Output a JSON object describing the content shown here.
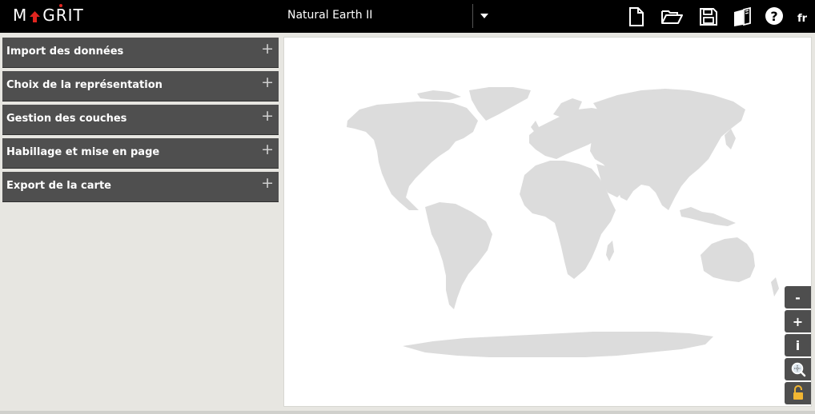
{
  "app": {
    "logo_text_left": "M",
    "logo_text_right": "GRIT",
    "brand_accent": "#e1251f",
    "bar_color": "#000000"
  },
  "header": {
    "projection": "Natural Earth II",
    "language": "fr",
    "icons": [
      "new-file-icon",
      "open-folder-icon",
      "save-icon",
      "book-icon",
      "help-icon"
    ]
  },
  "menu": {
    "items": [
      {
        "label": "Import des données",
        "toggle": "+"
      },
      {
        "label": "Choix de la représentation",
        "toggle": "+"
      },
      {
        "label": "Gestion des couches",
        "toggle": "+"
      },
      {
        "label": "Habillage et mise en page",
        "toggle": "+"
      },
      {
        "label": "Export de la carte",
        "toggle": "+"
      }
    ]
  },
  "map": {
    "land_color": "#dcdcdc",
    "controls": {
      "zoom_out": "-",
      "zoom_in": "+",
      "info": "i",
      "zoom_extent_icon": "magnifier-icon",
      "lock_icon": "lock-icon"
    }
  }
}
